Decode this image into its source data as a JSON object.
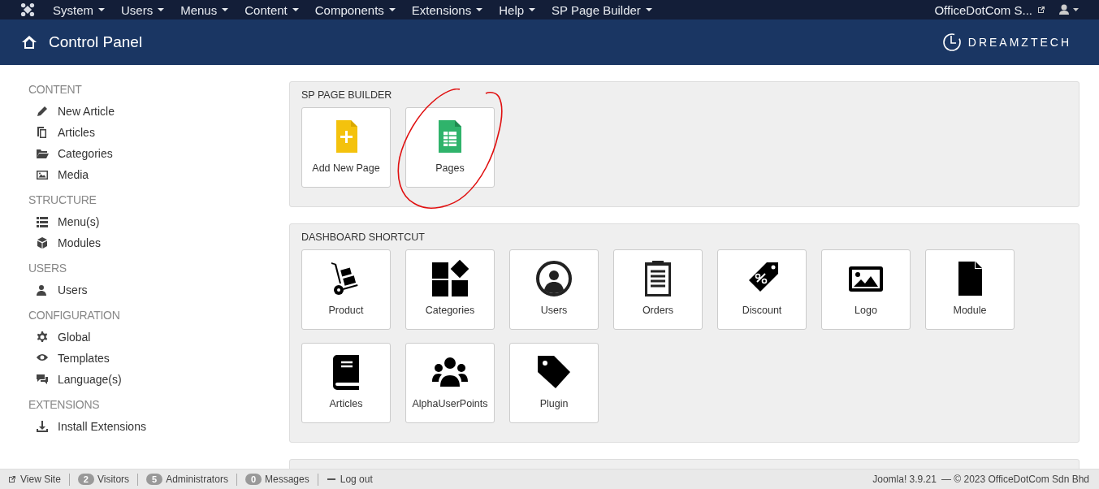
{
  "top_menu": [
    {
      "label": "System"
    },
    {
      "label": "Users"
    },
    {
      "label": "Menus"
    },
    {
      "label": "Content"
    },
    {
      "label": "Components"
    },
    {
      "label": "Extensions"
    },
    {
      "label": "Help"
    },
    {
      "label": "SP Page Builder"
    }
  ],
  "site_link": "OfficeDotCom S...",
  "header": {
    "title": "Control Panel",
    "brand": "DREAMZTECH"
  },
  "sidebar": [
    {
      "heading": "CONTENT",
      "items": [
        {
          "label": "New Article",
          "kind": "pencil"
        },
        {
          "label": "Articles",
          "kind": "copy"
        },
        {
          "label": "Categories",
          "kind": "folder"
        },
        {
          "label": "Media",
          "kind": "image"
        }
      ]
    },
    {
      "heading": "STRUCTURE",
      "items": [
        {
          "label": "Menu(s)",
          "kind": "list"
        },
        {
          "label": "Modules",
          "kind": "cube"
        }
      ]
    },
    {
      "heading": "USERS",
      "items": [
        {
          "label": "Users",
          "kind": "user"
        }
      ]
    },
    {
      "heading": "CONFIGURATION",
      "items": [
        {
          "label": "Global",
          "kind": "gear"
        },
        {
          "label": "Templates",
          "kind": "eye"
        },
        {
          "label": "Language(s)",
          "kind": "chat"
        }
      ]
    },
    {
      "heading": "EXTENSIONS",
      "items": [
        {
          "label": "Install Extensions",
          "kind": "download"
        }
      ]
    }
  ],
  "panels": [
    {
      "title": "SP PAGE BUILDER",
      "annotated": true,
      "tiles": [
        {
          "label": "Add New Page",
          "kind": "add"
        },
        {
          "label": "Pages",
          "kind": "pages"
        }
      ]
    },
    {
      "title": "DASHBOARD SHORTCUT",
      "annotated": false,
      "tiles": [
        {
          "label": "Product",
          "kind": "truck"
        },
        {
          "label": "Categories",
          "kind": "blocks"
        },
        {
          "label": "Users",
          "kind": "person"
        },
        {
          "label": "Orders",
          "kind": "clipboard"
        },
        {
          "label": "Discount",
          "kind": "tag-percent"
        },
        {
          "label": "Logo",
          "kind": "picture"
        },
        {
          "label": "Module",
          "kind": "file"
        },
        {
          "label": "Articles",
          "kind": "book"
        },
        {
          "label": "AlphaUserPoints",
          "kind": "group"
        },
        {
          "label": "Plugin",
          "kind": "tag"
        }
      ]
    }
  ],
  "status_bar": {
    "view_site": "View Site",
    "counters": [
      {
        "count": "2",
        "label": "Visitors"
      },
      {
        "count": "5",
        "label": "Administrators"
      },
      {
        "count": "0",
        "label": "Messages"
      }
    ],
    "logout": "Log out",
    "version": "Joomla! 3.9.21",
    "copyright": "— © 2023 OfficeDotCom Sdn Bhd"
  }
}
